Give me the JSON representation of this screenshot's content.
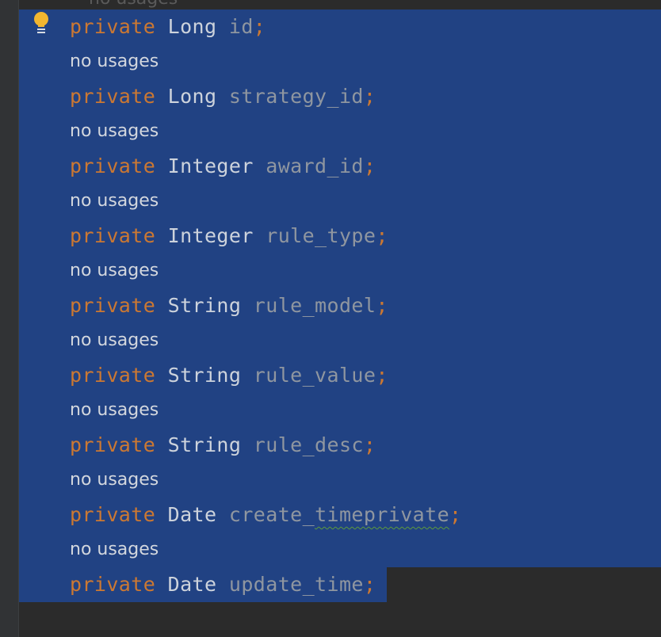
{
  "editor": {
    "lines": [
      {
        "kind": "code",
        "keyword": "private",
        "type": "Long",
        "name": "id",
        "semi": ";"
      },
      {
        "kind": "hint",
        "text": "no usages"
      },
      {
        "kind": "code",
        "keyword": "private",
        "type": "Long",
        "name": "strategy_id",
        "semi": ";"
      },
      {
        "kind": "hint",
        "text": "no usages"
      },
      {
        "kind": "code",
        "keyword": "private",
        "type": "Integer",
        "name": "award_id",
        "semi": ";"
      },
      {
        "kind": "hint",
        "text": "no usages"
      },
      {
        "kind": "code",
        "keyword": "private",
        "type": "Integer",
        "name": "rule_type",
        "semi": ";"
      },
      {
        "kind": "hint",
        "text": "no usages"
      },
      {
        "kind": "code",
        "keyword": "private",
        "type": "String",
        "name": "rule_model",
        "semi": ";"
      },
      {
        "kind": "hint",
        "text": "no usages"
      },
      {
        "kind": "code",
        "keyword": "private",
        "type": "String",
        "name": "rule_value",
        "semi": ";"
      },
      {
        "kind": "hint",
        "text": "no usages"
      },
      {
        "kind": "code",
        "keyword": "private",
        "type": "String",
        "name": "rule_desc",
        "semi": ";"
      },
      {
        "kind": "hint",
        "text": "no usages"
      },
      {
        "kind": "code",
        "keyword": "private",
        "type": "Date",
        "name_prefix": "create_",
        "name_warn": "timeprivate",
        "semi": ";"
      },
      {
        "kind": "hint",
        "text": "no usages"
      },
      {
        "kind": "code",
        "keyword": "private",
        "type": "Date",
        "name": "update_time",
        "semi": ";"
      }
    ]
  },
  "icons": {
    "intention_bulb": "lightbulb-icon"
  },
  "colors": {
    "background": "#2b2b2b",
    "selection": "#214283",
    "keyword": "#cc7832",
    "type": "#cdd3dc",
    "field": "#8f96a0",
    "hint": "#d3d7de",
    "bulb": "#f2b630",
    "warning_underline": "#5d9a3c"
  }
}
